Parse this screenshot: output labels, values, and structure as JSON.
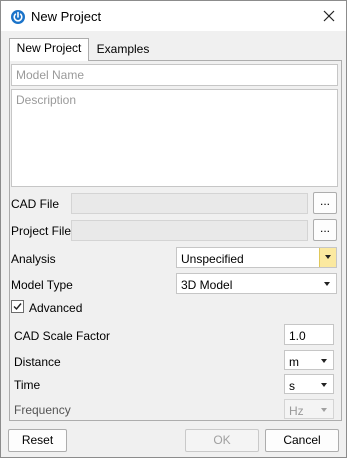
{
  "window": {
    "title": "New Project",
    "icon": "power-icon",
    "accent": "#1a73c9"
  },
  "tabs": [
    {
      "label": "New Project",
      "active": true
    },
    {
      "label": "Examples",
      "active": false
    }
  ],
  "form": {
    "model_name_placeholder": "Model Name",
    "description_placeholder": "Description",
    "cad_file_label": "CAD File",
    "project_file_label": "Project File",
    "browse_label": "...",
    "analysis_label": "Analysis",
    "analysis_value": "Unspecified",
    "model_type_label": "Model Type",
    "model_type_value": "3D Model",
    "advanced_label": "Advanced",
    "advanced_checked": true
  },
  "advanced": {
    "cad_scale_label": "CAD Scale Factor",
    "cad_scale_value": "1.0",
    "distance_label": "Distance",
    "distance_value": "m",
    "time_label": "Time",
    "time_value": "s",
    "frequency_label": "Frequency",
    "frequency_value": "Hz"
  },
  "buttons": {
    "reset": "Reset",
    "ok": "OK",
    "cancel": "Cancel"
  }
}
